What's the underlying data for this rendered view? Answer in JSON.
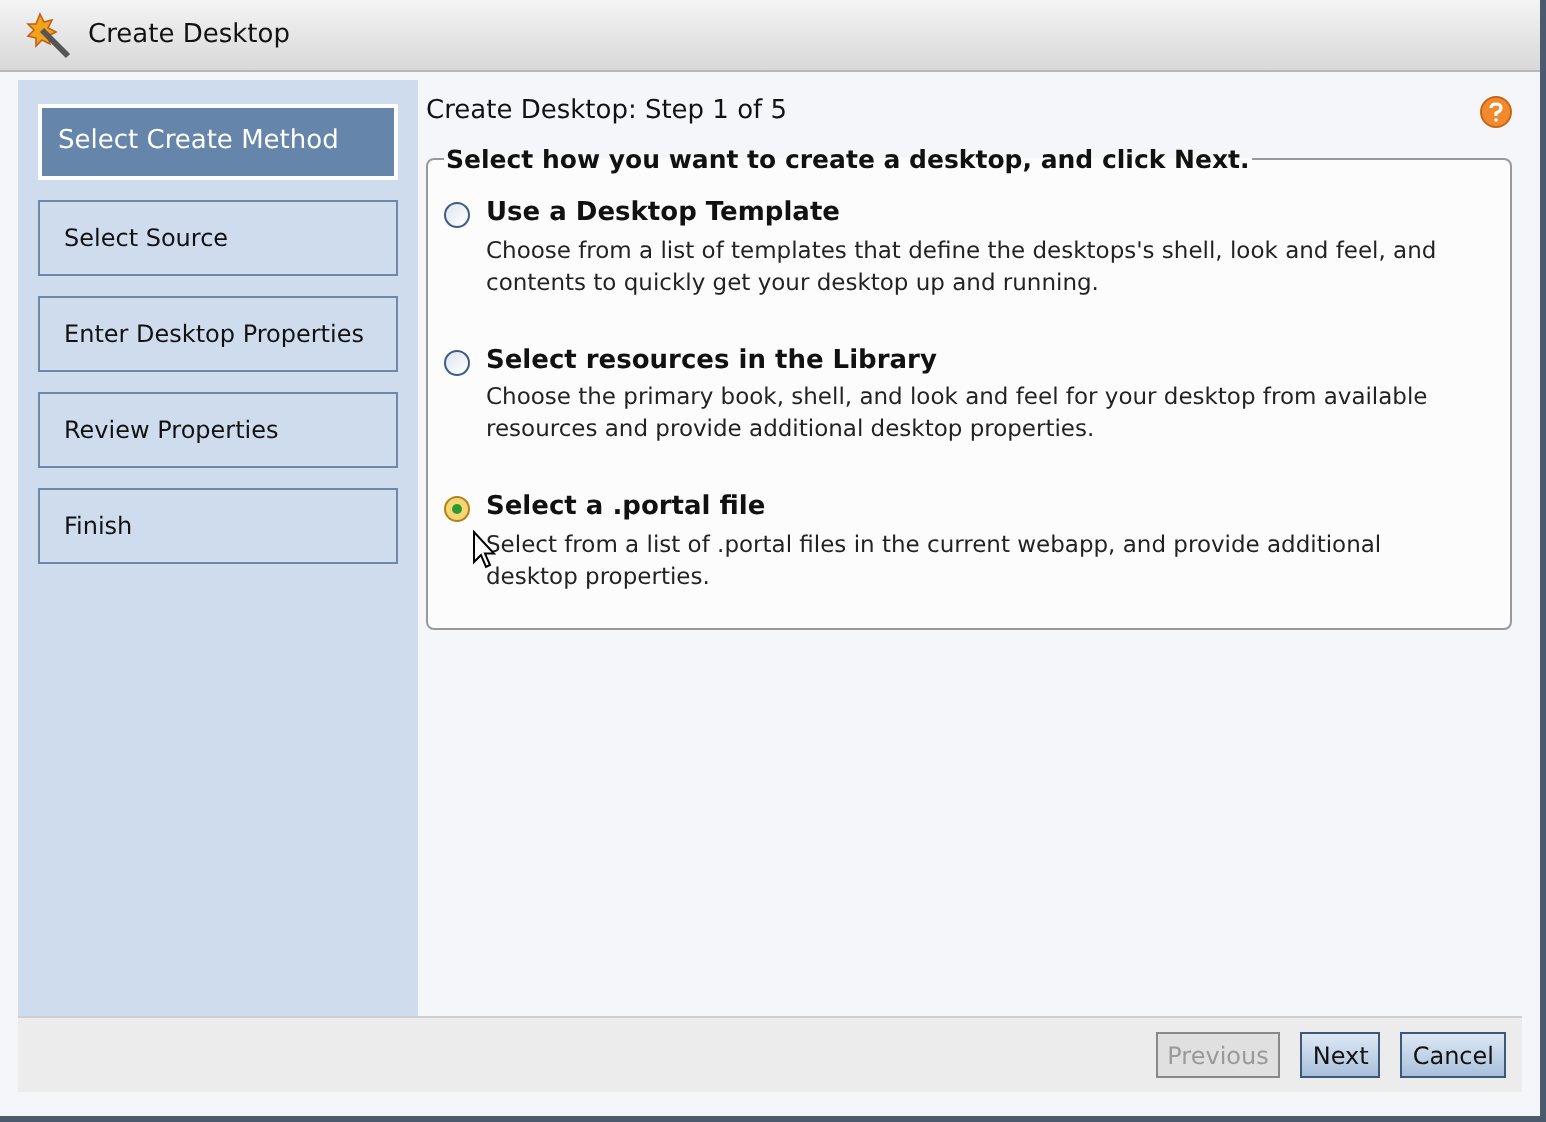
{
  "window": {
    "title": "Create Desktop"
  },
  "steps": [
    {
      "label": "Select Create Method",
      "selected": true
    },
    {
      "label": "Select Source",
      "selected": false
    },
    {
      "label": "Enter Desktop Properties",
      "selected": false
    },
    {
      "label": "Review Properties",
      "selected": false
    },
    {
      "label": "Finish",
      "selected": false
    }
  ],
  "heading": "Create Desktop: Step 1 of 5",
  "group": {
    "legend": "Select how you want to create a desktop, and click Next.",
    "options": [
      {
        "title": "Use a Desktop Template",
        "description": "Choose from a list of templates that define the desktops's shell, look and feel, and contents to quickly get your desktop up and running.",
        "selected": false
      },
      {
        "title": "Select resources in the Library",
        "description": "Choose the primary book, shell, and look and feel for your desktop from available resources and provide additional desktop properties.",
        "selected": false
      },
      {
        "title": "Select a .portal file",
        "description": "Select from a list of .portal files in the current webapp, and provide additional desktop properties.",
        "selected": true
      }
    ]
  },
  "buttons": [
    {
      "label": "Previous",
      "disabled": true
    },
    {
      "label": "Next",
      "disabled": false
    },
    {
      "label": "Cancel",
      "disabled": false
    }
  ]
}
